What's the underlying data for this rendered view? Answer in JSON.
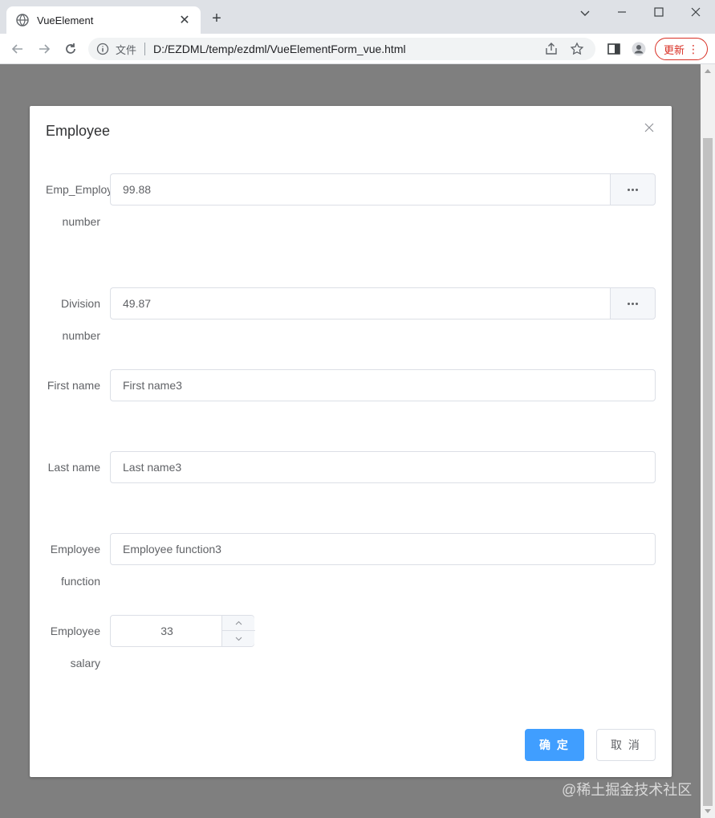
{
  "browser": {
    "tab_title": "VueElement",
    "scheme_label": "文件",
    "url": "D:/EZDML/temp/ezdml/VueElementForm_vue.html",
    "update_label": "更新"
  },
  "dialog": {
    "title": "Employee",
    "fields": [
      {
        "label": "Emp_Employee number",
        "value": "99.88"
      },
      {
        "label": "Division number",
        "value": "49.87"
      },
      {
        "label": "First name",
        "value": "First name3"
      },
      {
        "label": "Last name",
        "value": "Last name3"
      },
      {
        "label": "Employee function",
        "value": "Employee function3"
      },
      {
        "label": "Employee salary",
        "value": "33"
      }
    ],
    "confirm_label": "确 定",
    "cancel_label": "取 消"
  },
  "watermark": "@稀土掘金技术社区",
  "colors": {
    "primary": "#409eff",
    "border": "#dcdfe6",
    "overlay": "#7f7f7f"
  }
}
